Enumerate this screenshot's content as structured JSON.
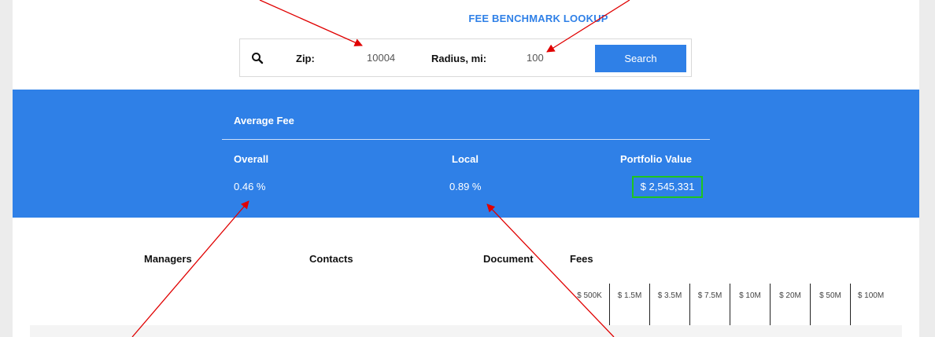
{
  "header": {
    "title": "FEE BENCHMARK LOOKUP"
  },
  "search": {
    "icon": "search-icon",
    "zip_label": "Zip:",
    "zip_value": "10004",
    "radius_label": "Radius, mi:",
    "radius_value": "100",
    "button_label": "Search"
  },
  "summary": {
    "title": "Average Fee",
    "overall_label": "Overall",
    "overall_value": "0.46 %",
    "local_label": "Local",
    "local_value": "0.89 %",
    "portfolio_label": "Portfolio Value",
    "portfolio_value": "$ 2,545,331"
  },
  "table": {
    "columns": [
      "Managers",
      "Contacts",
      "Document",
      "Fees"
    ],
    "fee_brackets": [
      "$ 500K",
      "$ 1.5M",
      "$ 3.5M",
      "$ 7.5M",
      "$ 10M",
      "$ 20M",
      "$ 50M",
      "$ 100M"
    ]
  },
  "colors": {
    "accent": "#2f80e7",
    "highlight": "#1fc41f",
    "arrow": "#e00000"
  }
}
